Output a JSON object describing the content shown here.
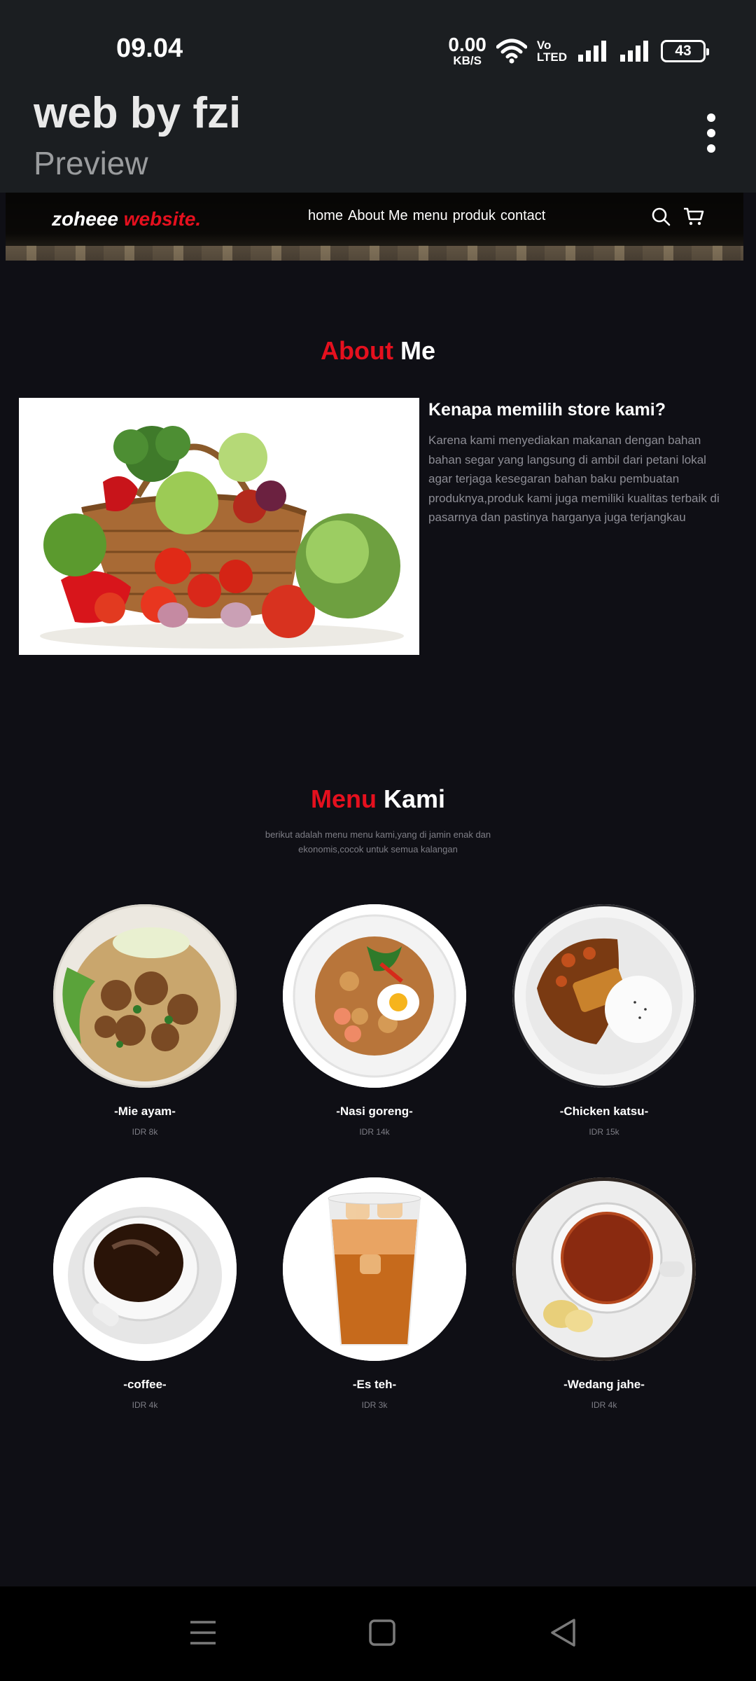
{
  "status_bar": {
    "time": "09.04",
    "net_speed_value": "0.00",
    "net_speed_unit": "KB/S",
    "volte_top": "Vo",
    "volte_bottom": "LTED",
    "battery": "43"
  },
  "app_bar": {
    "title": "web by fzi",
    "subtitle": "Preview"
  },
  "navbar": {
    "brand_part1": "zoheee",
    "brand_part2": "website.",
    "links": [
      "home",
      "About Me",
      "menu",
      "produk",
      "contact"
    ]
  },
  "about": {
    "title_red": "About",
    "title_white": "Me",
    "heading": "Kenapa memilih store kami?",
    "text": "Karena kami menyediakan makanan dengan bahan bahan segar yang langsung di ambil dari petani lokal agar terjaga kesegaran bahan baku pembuatan produknya,produk kami juga memiliki kualitas terbaik di pasarnya dan pastinya harganya juga terjangkau"
  },
  "menu": {
    "title_red": "Menu",
    "title_white": "Kami",
    "description": "berikut adalah menu menu kami,yang di jamin enak dan ekonomis,cocok untuk semua kalangan",
    "items": [
      {
        "name": "-Mie ayam-",
        "price": "IDR 8k"
      },
      {
        "name": "-Nasi goreng-",
        "price": "IDR 14k"
      },
      {
        "name": "-Chicken katsu-",
        "price": "IDR 15k"
      },
      {
        "name": "-coffee-",
        "price": "IDR 4k"
      },
      {
        "name": "-Es teh-",
        "price": "IDR 3k"
      },
      {
        "name": "-Wedang jahe-",
        "price": "IDR 4k"
      }
    ]
  },
  "colors": {
    "accent": "#e5101e",
    "page_bg": "#0f0f15",
    "header_bg": "#1b1e21"
  }
}
